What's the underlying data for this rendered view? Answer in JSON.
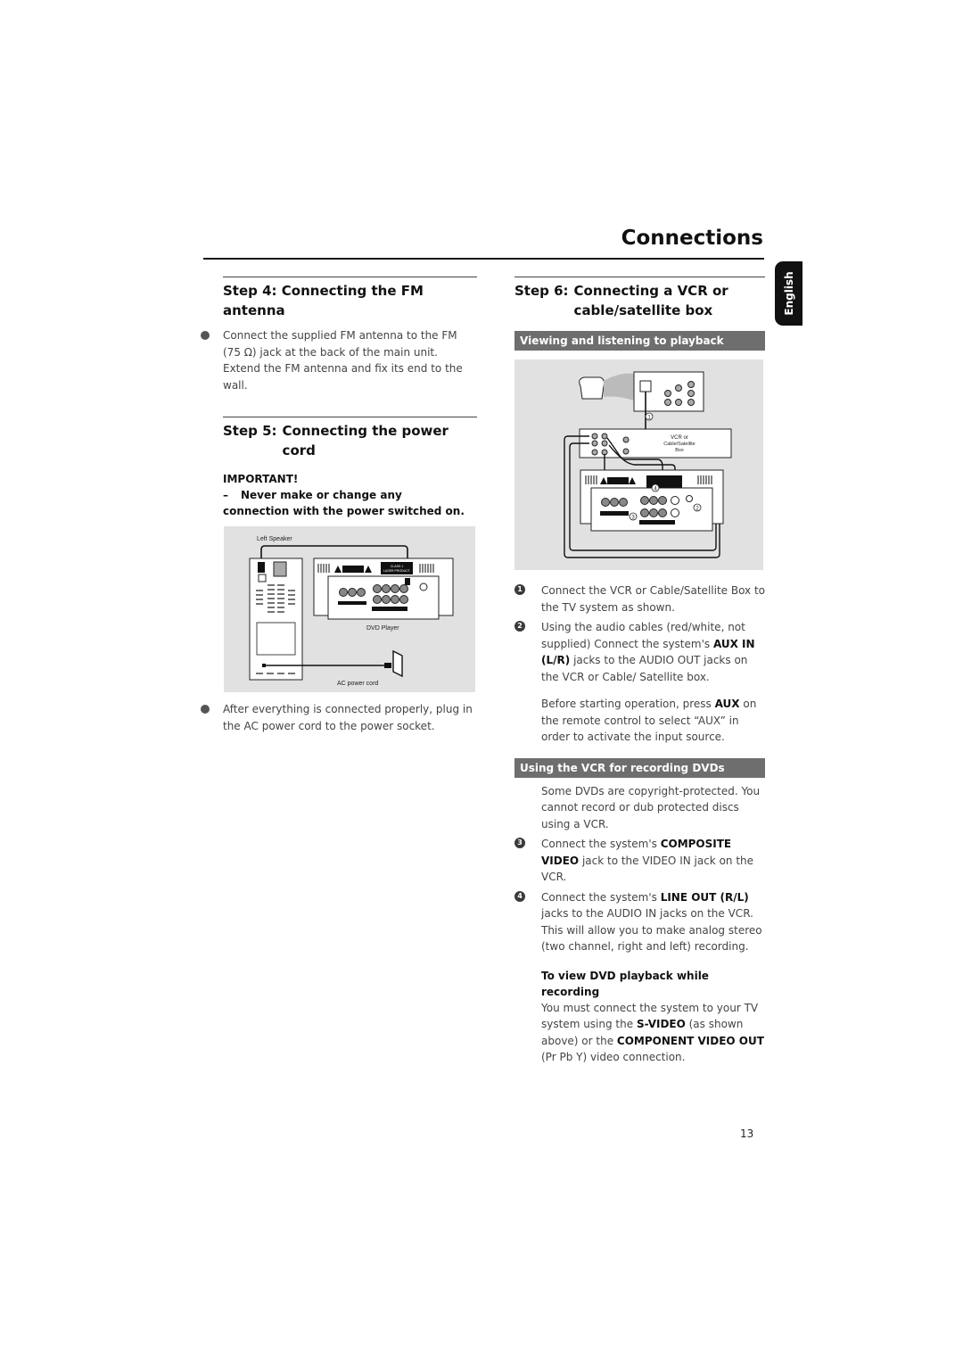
{
  "header": {
    "title": "Connections",
    "language_tab": "English"
  },
  "step4": {
    "step_label": "Step 4:",
    "title": "Connecting the FM antenna",
    "bullet": "Connect the supplied FM antenna to the FM (75 Ω) jack at the back of the main unit. Extend the FM antenna and fix its end to the wall."
  },
  "step5": {
    "step_label": "Step 5:",
    "title": "Connecting the power cord",
    "important_label": "IMPORTANT!",
    "important_dash": "–",
    "important_text_1": "Never make or change any",
    "important_text_2": "connection with the power switched on.",
    "figure": {
      "left_speaker_label": "Left Speaker",
      "dvd_player_label": "DVD Player",
      "ac_cord_label": "AC power cord",
      "class_label": "CLASS 1",
      "laser_label": "LASER PRODUCT"
    },
    "bullet": "After everything is connected properly, plug in the AC power cord to the power socket."
  },
  "step6": {
    "step_label": "Step 6:",
    "title": "Connecting a VCR or cable/satellite box",
    "subhead_playback": "Viewing and listening to playback",
    "figure": {
      "vcr_label_1": "VCR or",
      "vcr_label_2": "Cable/Satellite",
      "vcr_label_3": "Box",
      "callouts": [
        "1",
        "2",
        "3",
        "4"
      ]
    },
    "items_playback": [
      {
        "num": "1",
        "text": "Connect the VCR or Cable/Satellite Box to the TV system as shown."
      },
      {
        "num": "2",
        "pre": "Using the audio cables (red/white, not supplied) Connect the system's ",
        "bold": "AUX IN (L/R)",
        "post": " jacks to the AUDIO OUT jacks on the VCR or Cable/ Satellite box."
      }
    ],
    "aux_note": {
      "pre": "Before starting operation, press ",
      "bold": "AUX",
      "post": " on the remote control to select “AUX” in order to activate the input source."
    },
    "subhead_recording": "Using the VCR for recording DVDs",
    "recording_intro": "Some DVDs are copyright-protected. You cannot record or dub protected discs using a VCR.",
    "items_recording": [
      {
        "num": "3",
        "pre": "Connect the system's ",
        "bold": "COMPOSITE VIDEO",
        "post": " jack to the VIDEO IN jack on the VCR."
      },
      {
        "num": "4",
        "pre": "Connect the system's ",
        "bold": "LINE OUT (R/L)",
        "post": " jacks to the AUDIO IN jacks on the VCR. This will allow you to make analog stereo (two channel, right and left) recording."
      }
    ],
    "view_heading": "To view DVD playback while recording",
    "view_text": {
      "pre": "You must connect the system to your TV system using the ",
      "bold1": "S-VIDEO",
      "mid": " (as shown above) or the ",
      "bold2": "COMPONENT VIDEO OUT",
      "post": " (Pr Pb Y) video connection."
    }
  },
  "footer": {
    "page_number": "13"
  }
}
